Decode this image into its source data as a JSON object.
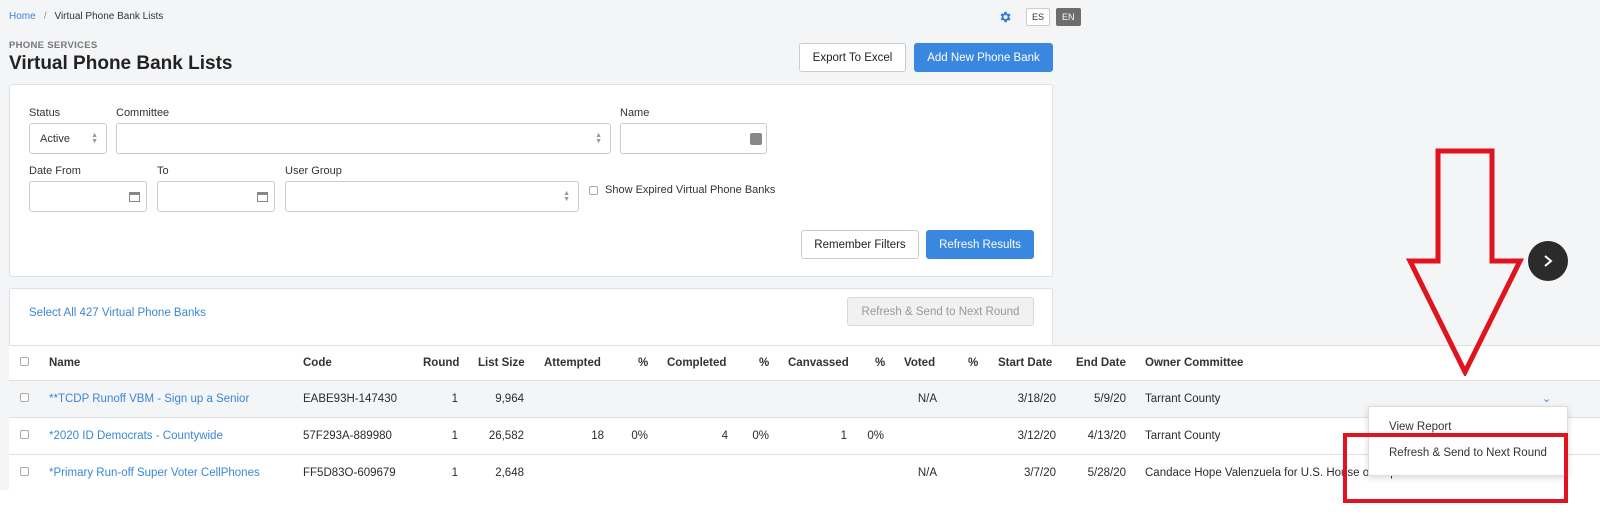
{
  "breadcrumb": {
    "home": "Home",
    "separator": "/",
    "current": "Virtual Phone Bank Lists"
  },
  "header": {
    "section": "PHONE SERVICES",
    "title": "Virtual Phone Bank Lists",
    "lang_es": "ES",
    "lang_en": "EN",
    "export_label": "Export To Excel",
    "add_label": "Add New Phone Bank"
  },
  "filters": {
    "status_label": "Status",
    "status_value": "Active",
    "committee_label": "Committee",
    "committee_value": "",
    "name_label": "Name",
    "name_value": "",
    "date_from_label": "Date From",
    "to_label": "To",
    "user_group_label": "User Group",
    "show_expired_label": "Show Expired Virtual Phone Banks",
    "remember_label": "Remember Filters",
    "refresh_label": "Refresh Results"
  },
  "list": {
    "select_all": "Select All 427 Virtual Phone Banks",
    "refresh_send_label": "Refresh & Send to Next Round",
    "columns": [
      "Name",
      "Code",
      "Round",
      "List Size",
      "Attempted",
      "%",
      "Completed",
      "%",
      "Canvassed",
      "%",
      "Voted",
      "%",
      "Start Date",
      "End Date",
      "Owner Committee"
    ],
    "rows": [
      {
        "name": "**TCDP Runoff VBM - Sign up a Senior",
        "code": "EABE93H-147430",
        "round": "1",
        "list_size": "9,964",
        "attempted": "",
        "attempted_pct": "",
        "completed": "",
        "completed_pct": "",
        "canvassed": "",
        "canvassed_pct": "",
        "voted": "N/A",
        "voted_pct": "",
        "start": "3/18/20",
        "end": "5/9/20",
        "owner": "Tarrant County"
      },
      {
        "name": "*2020 ID Democrats - Countywide",
        "code": "57F293A-889980",
        "round": "1",
        "list_size": "26,582",
        "attempted": "18",
        "attempted_pct": "0%",
        "completed": "4",
        "completed_pct": "0%",
        "canvassed": "1",
        "canvassed_pct": "0%",
        "voted": "",
        "voted_pct": "",
        "start": "3/12/20",
        "end": "4/13/20",
        "owner": "Tarrant County"
      },
      {
        "name": "*Primary Run-off Super Voter CellPhones",
        "code": "FF5D83O-609679",
        "round": "1",
        "list_size": "2,648",
        "attempted": "",
        "attempted_pct": "",
        "completed": "",
        "completed_pct": "",
        "canvassed": "",
        "canvassed_pct": "",
        "voted": "N/A",
        "voted_pct": "",
        "start": "3/7/20",
        "end": "5/28/20",
        "owner": "Candace Hope Valenzuela for U.S. House of Representatives District 24"
      }
    ]
  },
  "dropdown": {
    "view_report": "View Report",
    "refresh_send": "Refresh & Send to Next Round"
  },
  "icons": {
    "gear": "gear-icon",
    "next": "chevron-right-icon",
    "row_action": "chevron-down-icon",
    "annotation": "red-arrow-icon"
  },
  "colors": {
    "accent": "#3a87e0",
    "link": "#3a87d6",
    "annotation": "#e0141e"
  }
}
